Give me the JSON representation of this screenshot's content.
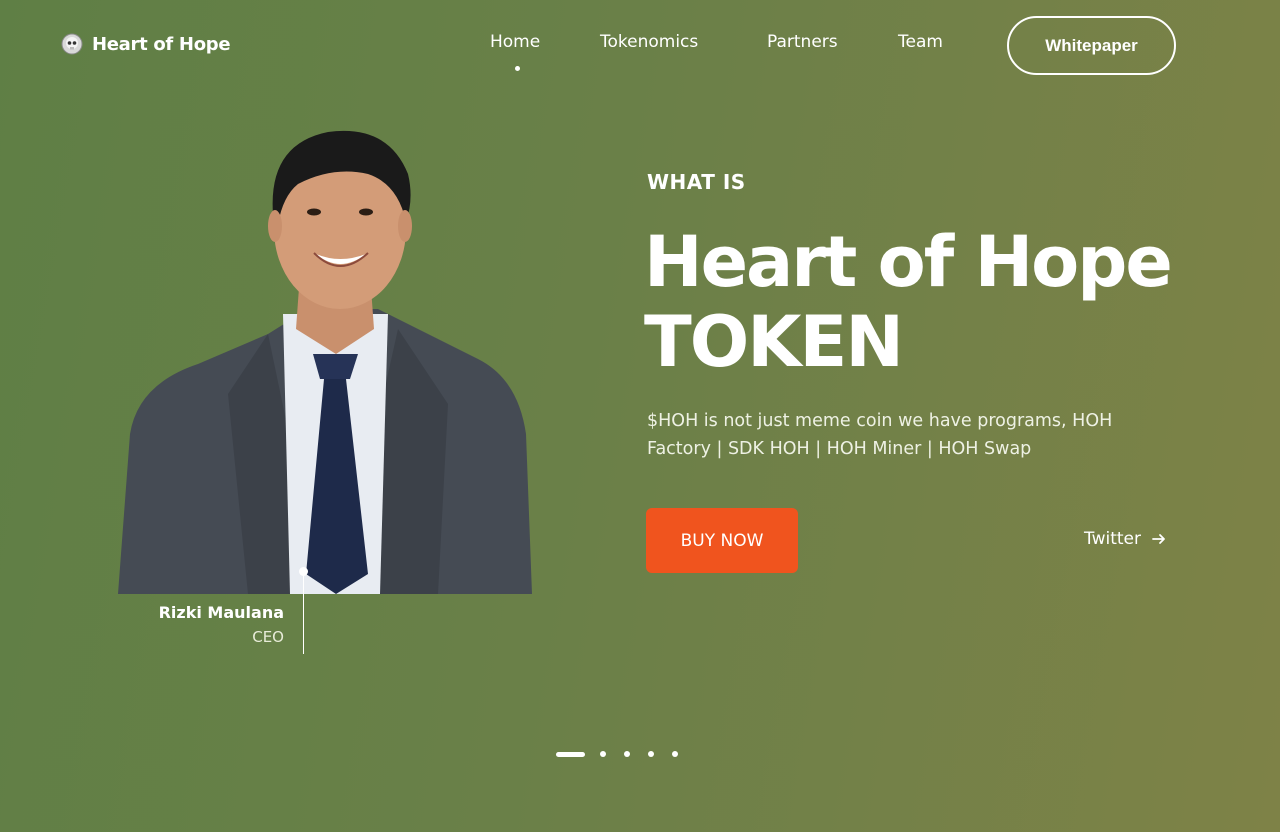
{
  "brand": {
    "name": "Heart of Hope",
    "logo_icon": "skull-coin-icon"
  },
  "nav": {
    "items": [
      {
        "label": "Home",
        "active": true
      },
      {
        "label": "Tokenomics",
        "active": false
      },
      {
        "label": "Partners",
        "active": false
      },
      {
        "label": "Team",
        "active": false
      }
    ],
    "cta_label": "Whitepaper"
  },
  "person": {
    "name": "Rizki Maulana",
    "role": "CEO"
  },
  "hero": {
    "eyebrow": "WHAT IS",
    "title_line1": "Heart of Hope",
    "title_line2": "TOKEN",
    "description": "$HOH is not just meme coin we have programs, HOH Factory | SDK HOH | HOH Miner | HOH Swap",
    "buy_label": "BUY NOW",
    "twitter_label": "Twitter",
    "twitter_icon": "arrow-right-icon"
  },
  "pagination": {
    "total": 5,
    "active": 1
  },
  "colors": {
    "accent": "#f0541e",
    "bg_start": "#5f7f45",
    "bg_end": "#7e8247",
    "text": "#ffffff"
  }
}
